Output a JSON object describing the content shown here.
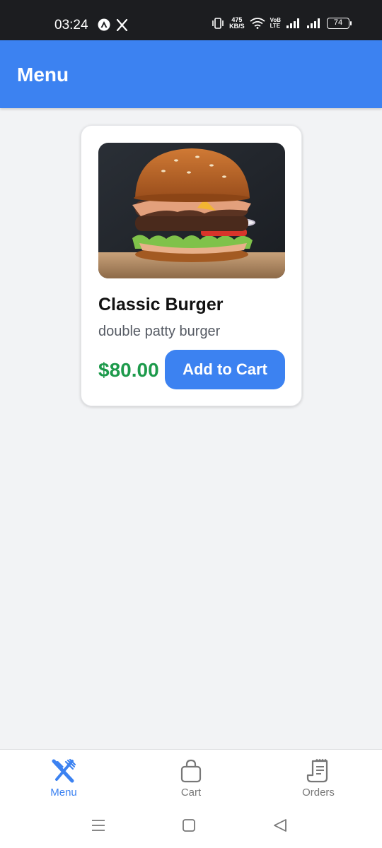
{
  "status_bar": {
    "time": "03:24",
    "speed_value": "475",
    "speed_unit": "KB/S",
    "network_label_top": "VoB",
    "network_label_bottom": "LTE",
    "battery": "74"
  },
  "app_bar": {
    "title": "Menu"
  },
  "menu_items": [
    {
      "name": "Classic Burger",
      "description": "double patty burger",
      "price": "$80.00",
      "button_label": "Add to Cart"
    }
  ],
  "tabs": [
    {
      "label": "Menu",
      "icon": "utensils-icon",
      "active": true
    },
    {
      "label": "Cart",
      "icon": "shopping-bag-icon",
      "active": false
    },
    {
      "label": "Orders",
      "icon": "receipt-icon",
      "active": false
    }
  ],
  "colors": {
    "primary": "#3c82f1",
    "price": "#1d9a4b",
    "background": "#f2f3f5"
  }
}
